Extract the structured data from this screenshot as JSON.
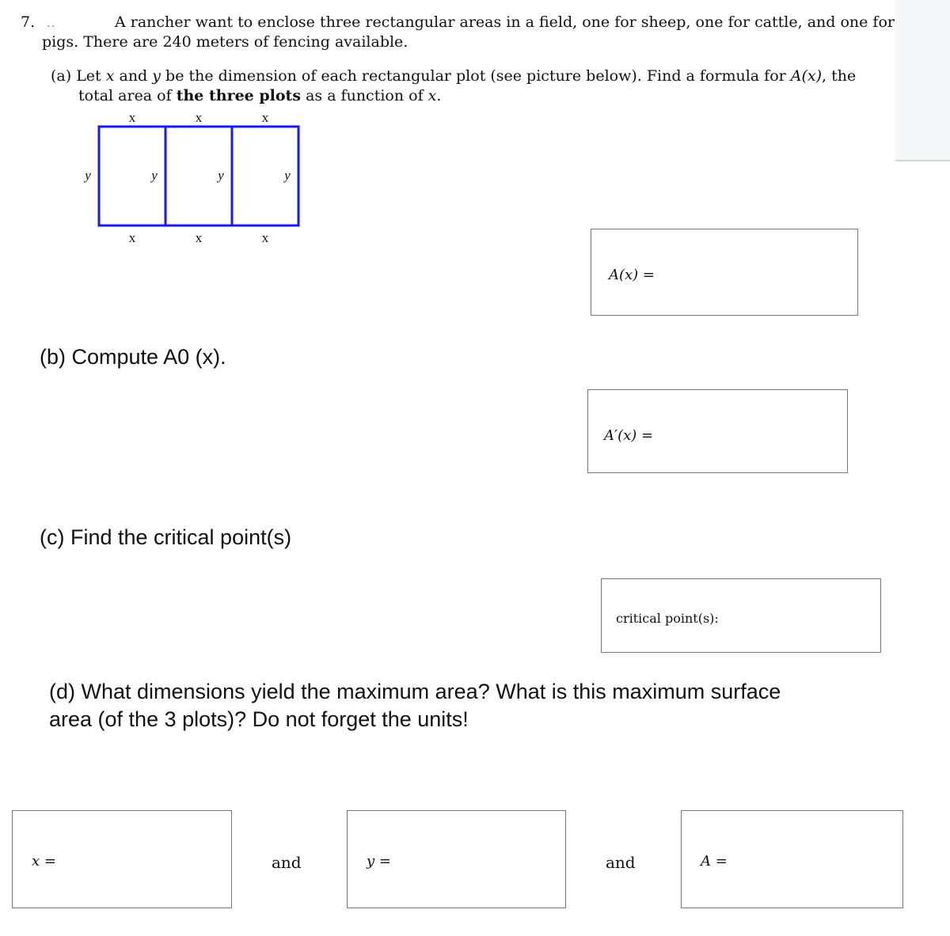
{
  "question": {
    "number": "7.",
    "intro_line1": "A rancher want to enclose three rectangular areas in a field, one for sheep, one for cattle, and one for",
    "intro_line2": "pigs. There are 240 meters of fencing available.",
    "part_a": {
      "line1_pre": "(a) Let ",
      "var_x": "x",
      "line1_mid1": " and ",
      "var_y": "y",
      "line1_mid2": " be the dimension of each rectangular plot (see picture below). Find a formula for ",
      "func": "A(x)",
      "line1_end": ", the",
      "line2_pre": "total area of ",
      "line2_bold": "the three plots",
      "line2_mid": " as a function of ",
      "line2_end": "."
    },
    "diagram": {
      "top_labels": [
        "x",
        "x",
        "x"
      ],
      "side_labels": [
        "y",
        "y",
        "y",
        "y"
      ],
      "bottom_labels": [
        "x",
        "x",
        "x"
      ],
      "plots": 3,
      "stroke_color": "#1a1aee"
    },
    "answer_a": {
      "label": "A(x) ="
    },
    "part_b": {
      "heading": "(b) Compute A0 (x)."
    },
    "answer_b": {
      "label": "A′(x) ="
    },
    "part_c": {
      "heading": "(c) Find the critical point(s)"
    },
    "answer_c": {
      "label": "critical point(s):"
    },
    "part_d": {
      "heading_line1": "(d) What dimensions yield the maximum area? What is this maximum surface",
      "heading_line2": "area (of the 3 plots)? Do not forget the units!"
    },
    "answers_d": {
      "x_label": "x =",
      "y_label": "y =",
      "a_label": "A =",
      "conjunction1": "and",
      "conjunction2": "and"
    }
  }
}
